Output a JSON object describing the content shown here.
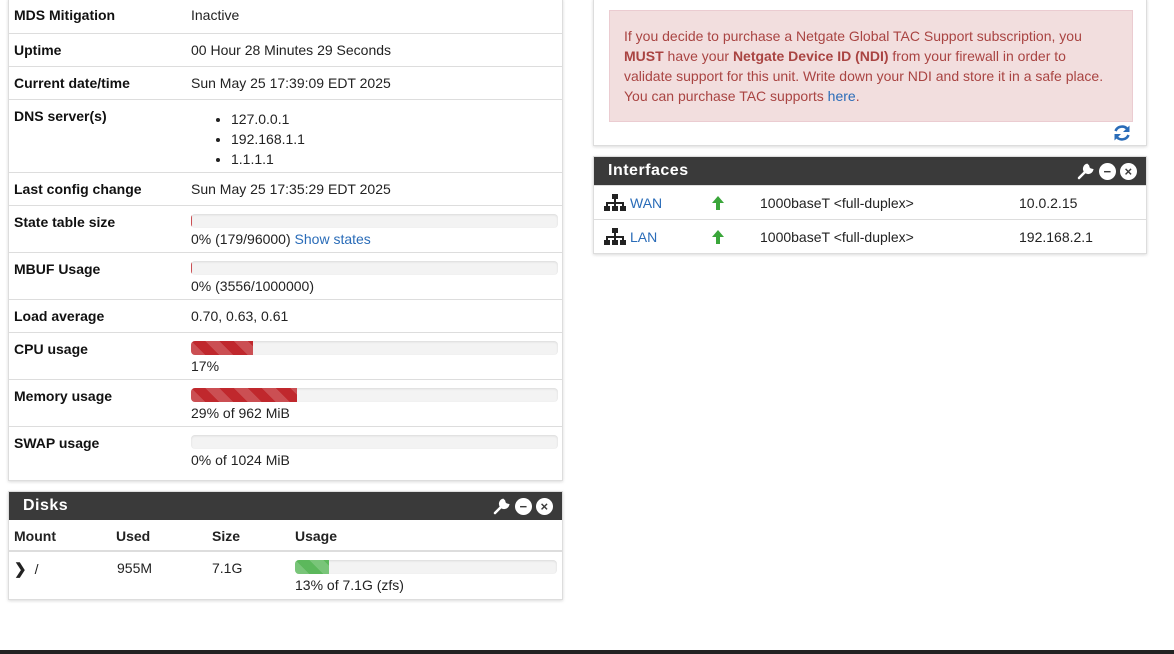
{
  "sysinfo": {
    "mds_label": "MDS Mitigation",
    "mds_value": "Inactive",
    "uptime_label": "Uptime",
    "uptime_value": "00 Hour 28 Minutes 29 Seconds",
    "datetime_label": "Current date/time",
    "datetime_value": "Sun May 25 17:39:09 EDT 2025",
    "dns_label": "DNS server(s)",
    "dns_servers": [
      "127.0.0.1",
      "192.168.1.1",
      "1.1.1.1"
    ],
    "lastconfig_label": "Last config change",
    "lastconfig_value": "Sun May 25 17:35:29 EDT 2025",
    "state_label": "State table size",
    "state_value": "0% (179/96000)",
    "state_link": "Show states",
    "state_fraction": 0.002,
    "mbuf_label": "MBUF Usage",
    "mbuf_value": "0% (3556/1000000)",
    "mbuf_fraction": 0.004,
    "load_label": "Load average",
    "load_value": "0.70, 0.63, 0.61",
    "cpu_label": "CPU usage",
    "cpu_value": "17%",
    "cpu_fraction": 0.17,
    "mem_label": "Memory usage",
    "mem_value": "29% of 962 MiB",
    "mem_fraction": 0.29,
    "swap_label": "SWAP usage",
    "swap_value": "0% of 1024 MiB",
    "swap_fraction": 0.0
  },
  "disks": {
    "title": "Disks",
    "headers": [
      "Mount",
      "Used",
      "Size",
      "Usage"
    ],
    "rows": [
      {
        "mount": "/",
        "used": "955M",
        "size": "7.1G",
        "usage": "13% of 7.1G (zfs)",
        "fraction": 0.13
      }
    ]
  },
  "alert": {
    "p1": "If you decide to purchase a Netgate Global TAC Support subscription, you ",
    "must": "MUST",
    "p2": " have your ",
    "ndi": "Netgate Device ID (NDI)",
    "p3": " from your firewall in order to validate support for this unit. Write down your NDI and store it in a safe place. You can purchase TAC supports ",
    "link": "here",
    "p4": "."
  },
  "interfaces": {
    "title": "Interfaces",
    "rows": [
      {
        "name": "WAN",
        "media": "1000baseT <full-duplex>",
        "ip": "10.0.2.15"
      },
      {
        "name": "LAN",
        "media": "1000baseT <full-duplex>",
        "ip": "192.168.2.1"
      }
    ]
  },
  "colors": {
    "bar_red": "#c0282d",
    "bar_green": "#5cb85c",
    "link": "#2a6cb8",
    "status_up": "#3aa63a",
    "header_bg": "#3a3a3a"
  },
  "icons": {
    "wrench": "wrench-icon",
    "minus": "collapse-icon",
    "close": "close-icon",
    "refresh": "refresh-icon",
    "network": "network-icon",
    "up": "arrow-up-icon",
    "expand": "chevron-right-icon"
  }
}
